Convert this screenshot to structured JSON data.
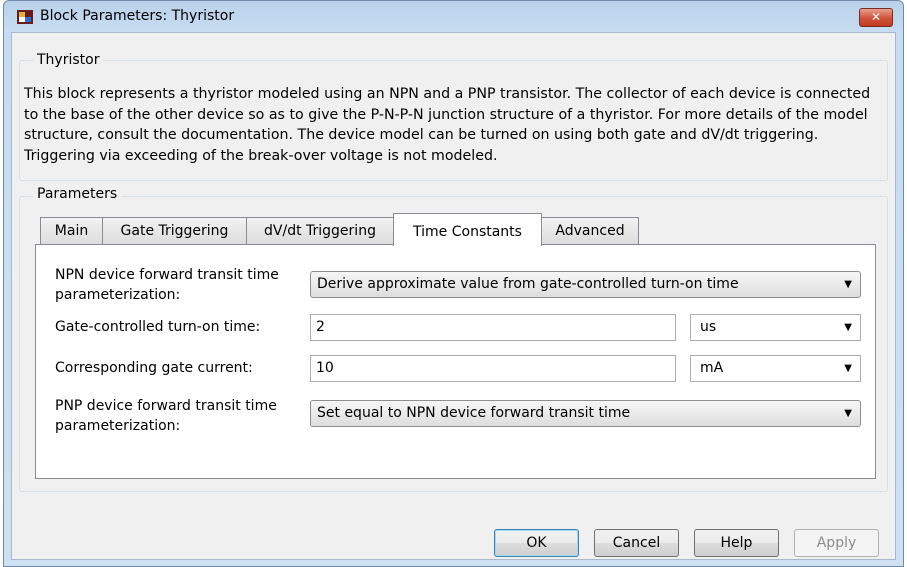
{
  "window": {
    "title": "Block Parameters: Thyristor",
    "close_label": "✕"
  },
  "block": {
    "group_title": "Thyristor",
    "description": "This block represents a thyristor modeled using an NPN and a PNP transistor. The collector of each device is connected to the base of the other device so as to give the P-N-P-N junction structure of a thyristor. For more details of the model structure, consult the documentation. The device model can be turned on using both gate and dV/dt triggering. Triggering via exceeding of the break-over voltage is not modeled."
  },
  "parameters": {
    "group_title": "Parameters",
    "tabs": [
      {
        "label": "Main"
      },
      {
        "label": "Gate Triggering"
      },
      {
        "label": "dV/dt Triggering"
      },
      {
        "label": "Time Constants"
      },
      {
        "label": "Advanced"
      }
    ],
    "active_tab": "Time Constants",
    "fields": {
      "npn_param": {
        "label_line1": "NPN device forward transit time",
        "label_line2": "parameterization:",
        "value": "Derive approximate value from gate-controlled turn-on time"
      },
      "turn_on_time": {
        "label": "Gate-controlled turn-on time:",
        "value": "2",
        "unit": "us"
      },
      "gate_current": {
        "label": "Corresponding gate current:",
        "value": "10",
        "unit": "mA"
      },
      "pnp_param": {
        "label_line1": "PNP device forward transit time",
        "label_line2": "parameterization:",
        "value": "Set equal to NPN device forward transit time"
      }
    }
  },
  "buttons": {
    "ok": "OK",
    "cancel": "Cancel",
    "help": "Help",
    "apply": "Apply"
  },
  "icons": {
    "app": "simulink-block-icon",
    "dropdown": "chevron-down-icon"
  },
  "colors": {
    "close_button": "#c9452b",
    "window_frame": "#c7dcf1",
    "dialog_bg": "#f0f0f0",
    "default_button_border": "#3c7fb1"
  }
}
